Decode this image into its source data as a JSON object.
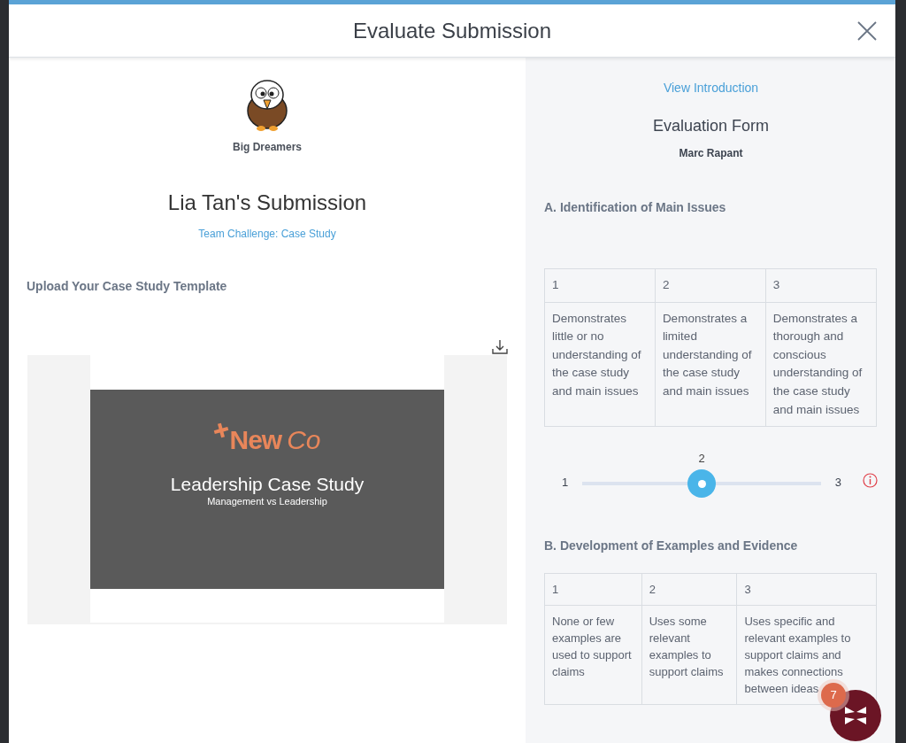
{
  "dialog": {
    "title": "Evaluate Submission"
  },
  "submission": {
    "team": "Big Dreamers",
    "title": "Lia Tan's Submission",
    "challenge_link": "Team Challenge: Case Study",
    "section_heading": "Upload Your Case Study Template",
    "slide": {
      "logo_bold": "New",
      "logo_light": "Co",
      "title": "Leadership Case Study",
      "subtitle": "Management vs Leadership"
    }
  },
  "evaluation": {
    "intro_link": "View Introduction",
    "form_title": "Evaluation Form",
    "evaluator": "Marc Rapant",
    "criteria": [
      {
        "heading": "A. Identification of Main Issues",
        "columns": [
          "1",
          "2",
          "3"
        ],
        "descriptions": [
          "Demonstrates little or no understanding of the case study and main issues",
          "Demonstrates a limited understanding of the case study and main issues",
          "Demonstrates a thorough and conscious understanding of the case study and main issues"
        ],
        "slider": {
          "min_label": "1",
          "max_label": "3",
          "value_label": "2",
          "level": 0.5
        }
      },
      {
        "heading": "B. Development of Examples and Evidence",
        "columns": [
          "1",
          "2",
          "3"
        ],
        "descriptions": [
          "None or few examples are used to support claims",
          "Uses some relevant examples to support claims",
          "Uses specific and relevant examples to support claims and makes connections between ideas"
        ]
      }
    ]
  },
  "chat": {
    "badge": "7"
  }
}
